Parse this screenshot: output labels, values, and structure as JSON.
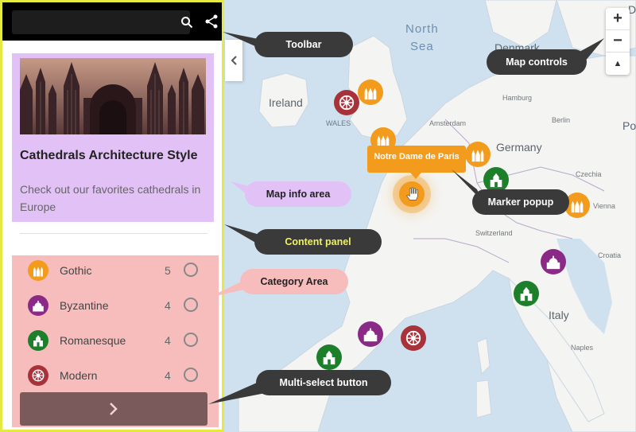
{
  "toolbar": {
    "search_placeholder": "",
    "search_icon": "search-icon",
    "share_icon": "share-icon"
  },
  "info": {
    "title": "Cathedrals Architecture Style",
    "description": "Check out our favorites cathedrals in Europe"
  },
  "categories": [
    {
      "label": "Gothic",
      "count": "5",
      "color": "#f29b1d",
      "icon": "gothic-cathedral-icon"
    },
    {
      "label": "Byzantine",
      "count": "4",
      "color": "#8a2a86",
      "icon": "byzantine-church-icon"
    },
    {
      "label": "Romanesque",
      "count": "4",
      "color": "#1e7f2b",
      "icon": "romanesque-church-icon"
    },
    {
      "label": "Modern",
      "count": "4",
      "color": "#a8323a",
      "icon": "modern-rose-window-icon"
    }
  ],
  "multiselect": {
    "icon": "chevron-right-icon"
  },
  "map": {
    "popup": "Notre Dame de Paris",
    "labels": {
      "north_sea": "North\nSea",
      "ireland": "Ireland",
      "wales": "WALES",
      "denmark": "Denmark",
      "hamburg": "Hamburg",
      "berlin": "Berlin",
      "amsterdam": "Amsterdam",
      "germany": "Germany",
      "czechia": "Czechia",
      "vienna": "Vienna",
      "switzerland": "Switzerland",
      "croatia": "Croatia",
      "italy": "Italy",
      "naples": "Naples",
      "po": "Po",
      "d": "D"
    },
    "controls": {
      "zoom_in": "+",
      "zoom_out": "−",
      "compass": "▲"
    }
  },
  "callouts": {
    "toolbar": "Toolbar",
    "map_controls": "Map controls",
    "map_info_area": "Map info area",
    "marker_popup": "Marker popup",
    "content_panel": "Content panel",
    "category_area": "Category Area",
    "multi_select_button": "Multi-select button"
  }
}
